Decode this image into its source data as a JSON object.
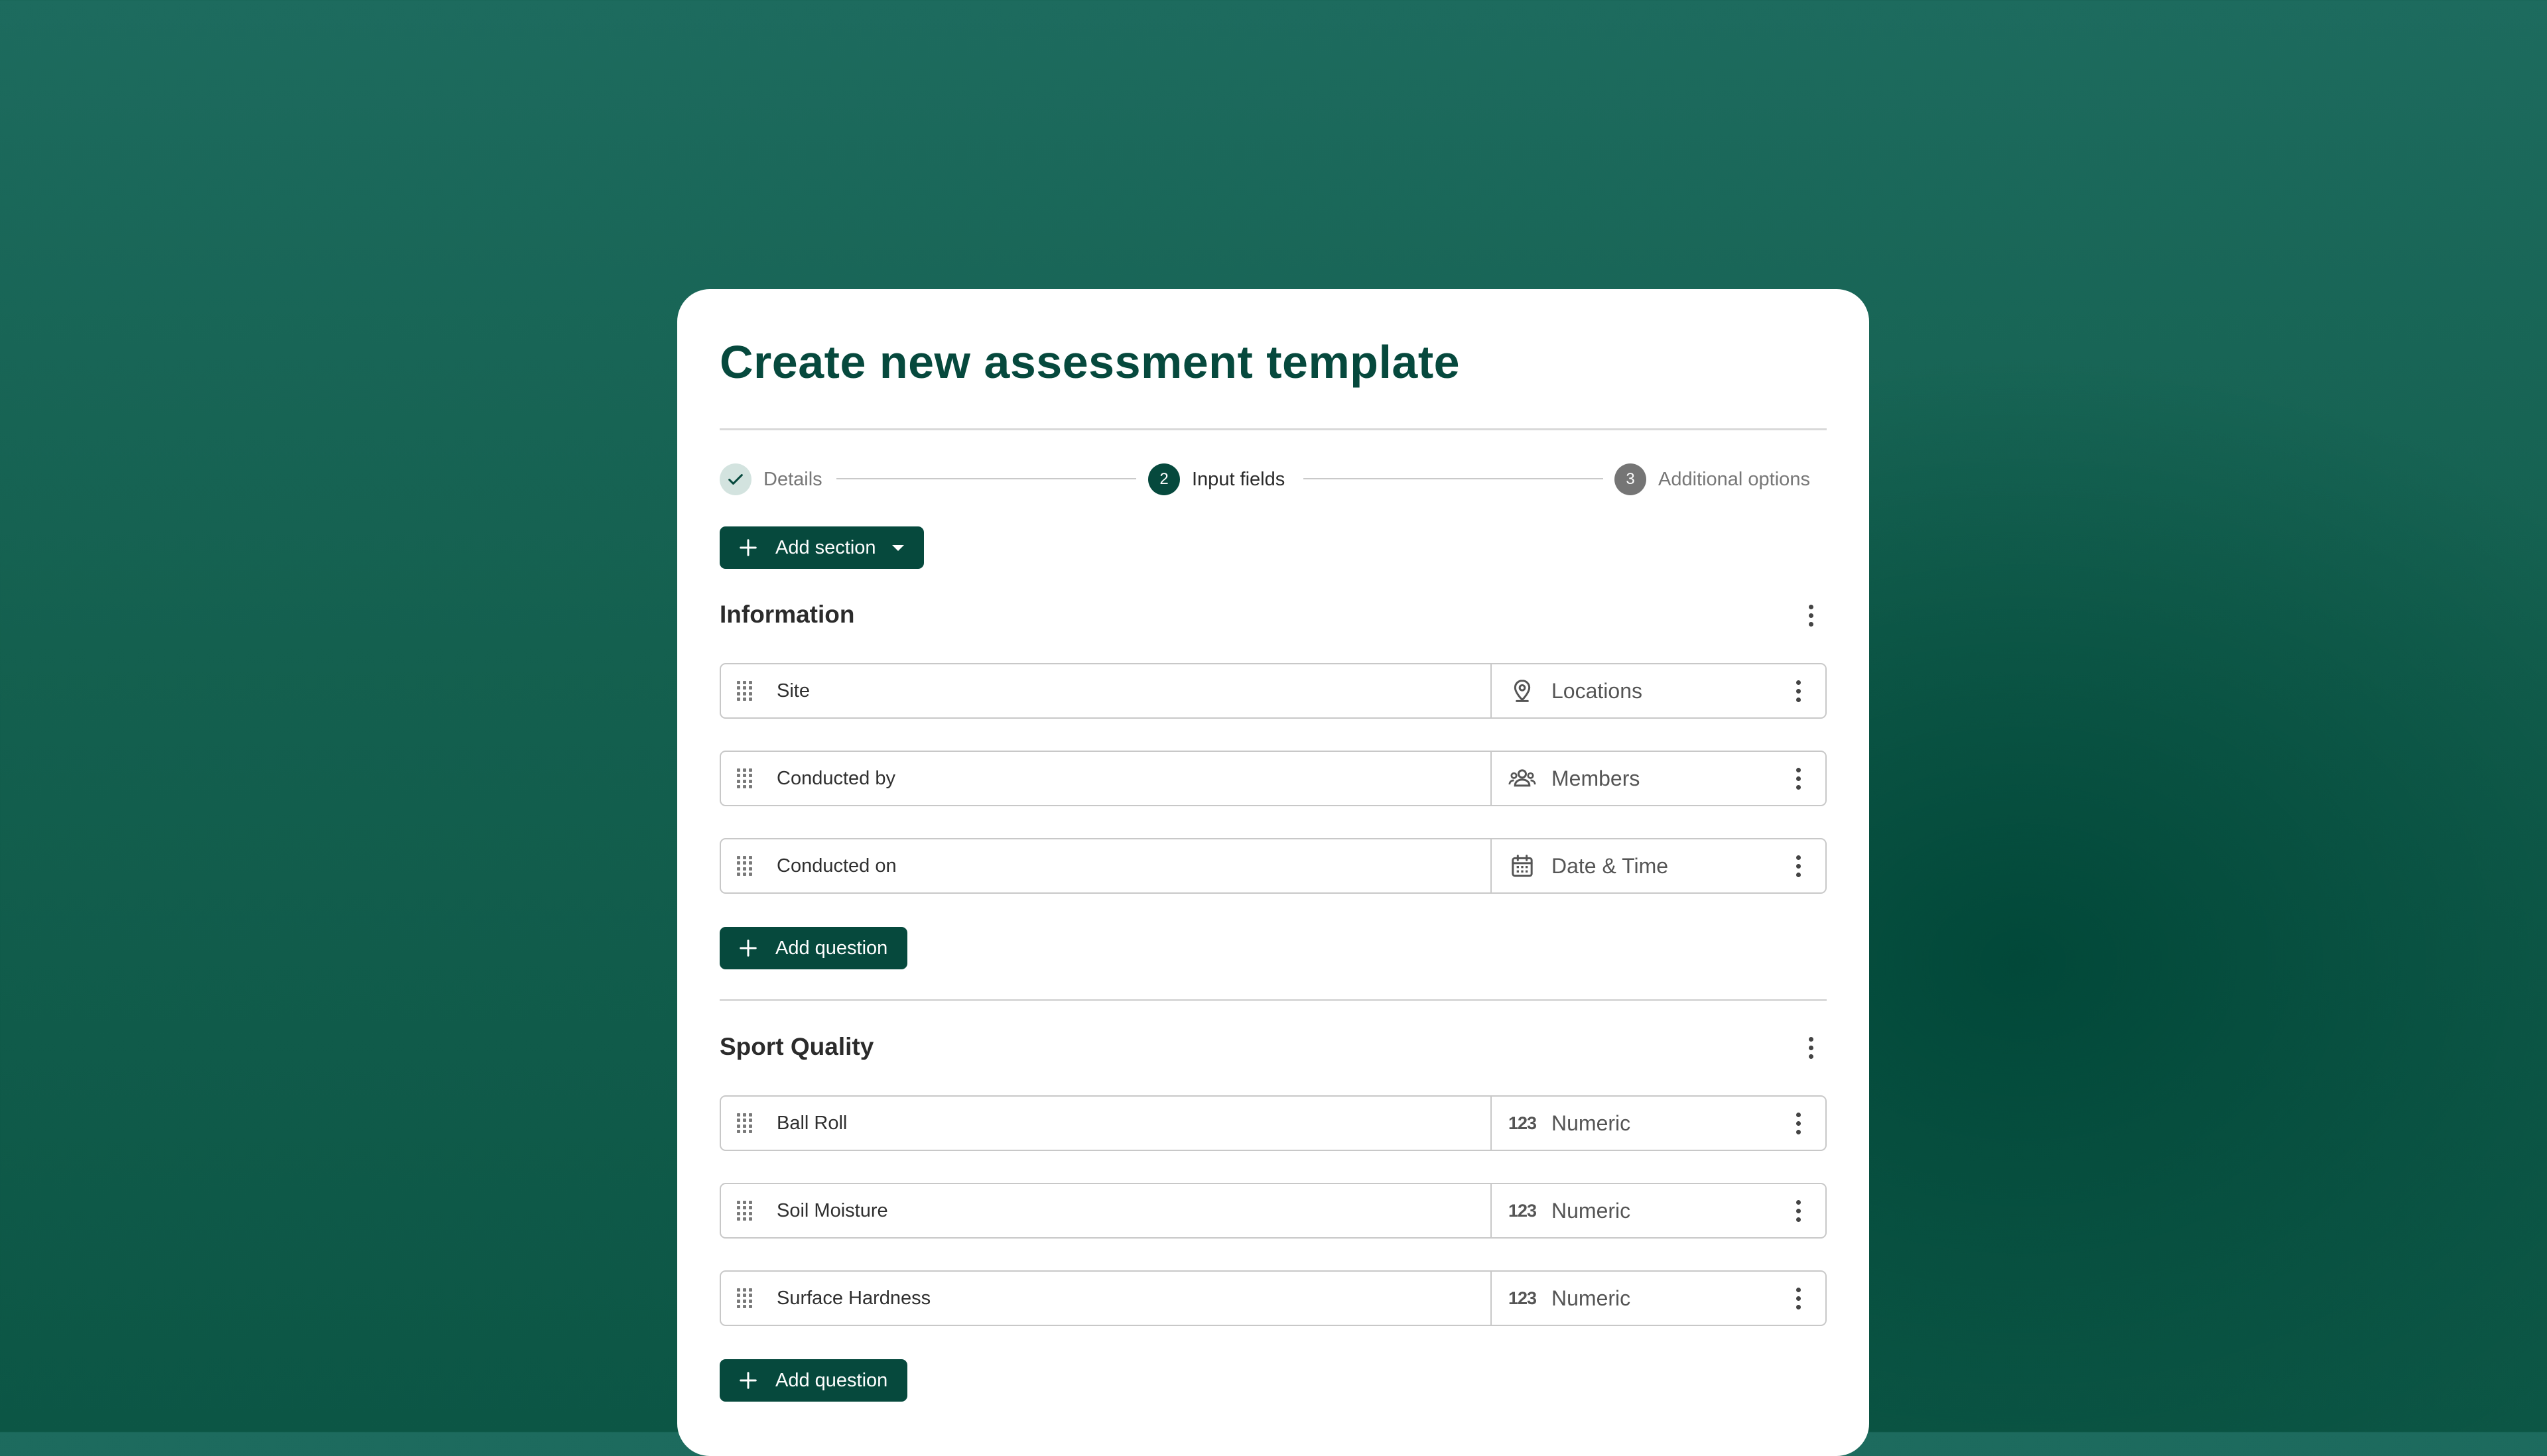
{
  "title": "Create new assessment template",
  "stepper": {
    "steps": [
      {
        "number": "",
        "label": "Details",
        "state": "completed",
        "icon": "check-icon"
      },
      {
        "number": "2",
        "label": "Input fields",
        "state": "active"
      },
      {
        "number": "3",
        "label": "Additional options",
        "state": "upcoming"
      }
    ]
  },
  "add_section_button": {
    "label": "Add section",
    "icon": "plus-icon",
    "dropdown_icon": "caret-down-icon"
  },
  "sections": [
    {
      "title": "Information",
      "questions": [
        {
          "label": "Site",
          "type_label": "Locations",
          "type_icon": "location-pin-icon"
        },
        {
          "label": "Conducted by",
          "type_label": "Members",
          "type_icon": "members-icon"
        },
        {
          "label": "Conducted on",
          "type_label": "Date & Time",
          "type_icon": "calendar-icon"
        }
      ],
      "add_question_label": "Add question"
    },
    {
      "title": "Sport Quality",
      "questions": [
        {
          "label": "Ball Roll",
          "type_label": "Numeric",
          "type_icon": "numeric-icon",
          "type_icon_text": "123"
        },
        {
          "label": "Soil Moisture",
          "type_label": "Numeric",
          "type_icon": "numeric-icon",
          "type_icon_text": "123"
        },
        {
          "label": "Surface Hardness",
          "type_label": "Numeric",
          "type_icon": "numeric-icon",
          "type_icon_text": "123"
        }
      ],
      "add_question_label": "Add question"
    }
  ],
  "colors": {
    "primary": "#06493d",
    "background_top": "#1d6b5e",
    "background_dark": "#004637",
    "step_completed_bg": "#d3e3df",
    "step_upcoming_bg": "#757575"
  }
}
